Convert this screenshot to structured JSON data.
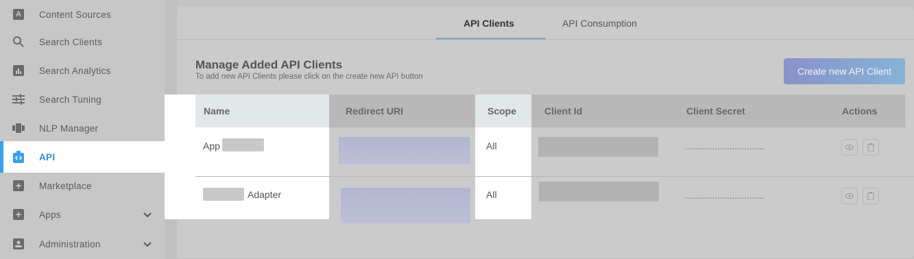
{
  "sidebar": {
    "items": [
      {
        "label": "Content Sources",
        "icon": "content-sources-icon"
      },
      {
        "label": "Search Clients",
        "icon": "search-icon"
      },
      {
        "label": "Search Analytics",
        "icon": "analytics-icon"
      },
      {
        "label": "Search Tuning",
        "icon": "tuning-sliders-icon"
      },
      {
        "label": "NLP Manager",
        "icon": "nlp-icon"
      },
      {
        "label": "API",
        "icon": "api-icon",
        "active": true
      },
      {
        "label": "Marketplace",
        "icon": "plus-square-icon"
      },
      {
        "label": "Apps",
        "icon": "plus-square-icon",
        "expandable": true
      },
      {
        "label": "Administration",
        "icon": "admin-icon",
        "expandable": true
      }
    ]
  },
  "tabs": [
    {
      "label": "API Clients",
      "active": true
    },
    {
      "label": "API Consumption",
      "active": false
    }
  ],
  "section": {
    "title": "Manage Added API Clients",
    "subtitle": "To add new API Clients please click on the create new API button",
    "create_button": "Create new API Client"
  },
  "table": {
    "columns": [
      "Name",
      "Redirect URI",
      "Scope",
      "Client Id",
      "Client Secret",
      "Actions"
    ],
    "rows": [
      {
        "name": "App",
        "scope": "All",
        "secret": "................................"
      },
      {
        "name": "Adapter",
        "scope": "All",
        "secret": "................................"
      }
    ]
  },
  "colors": {
    "accent": "#3aa0e8",
    "button_start": "#8a91c9",
    "button_end": "#86b3d6"
  }
}
